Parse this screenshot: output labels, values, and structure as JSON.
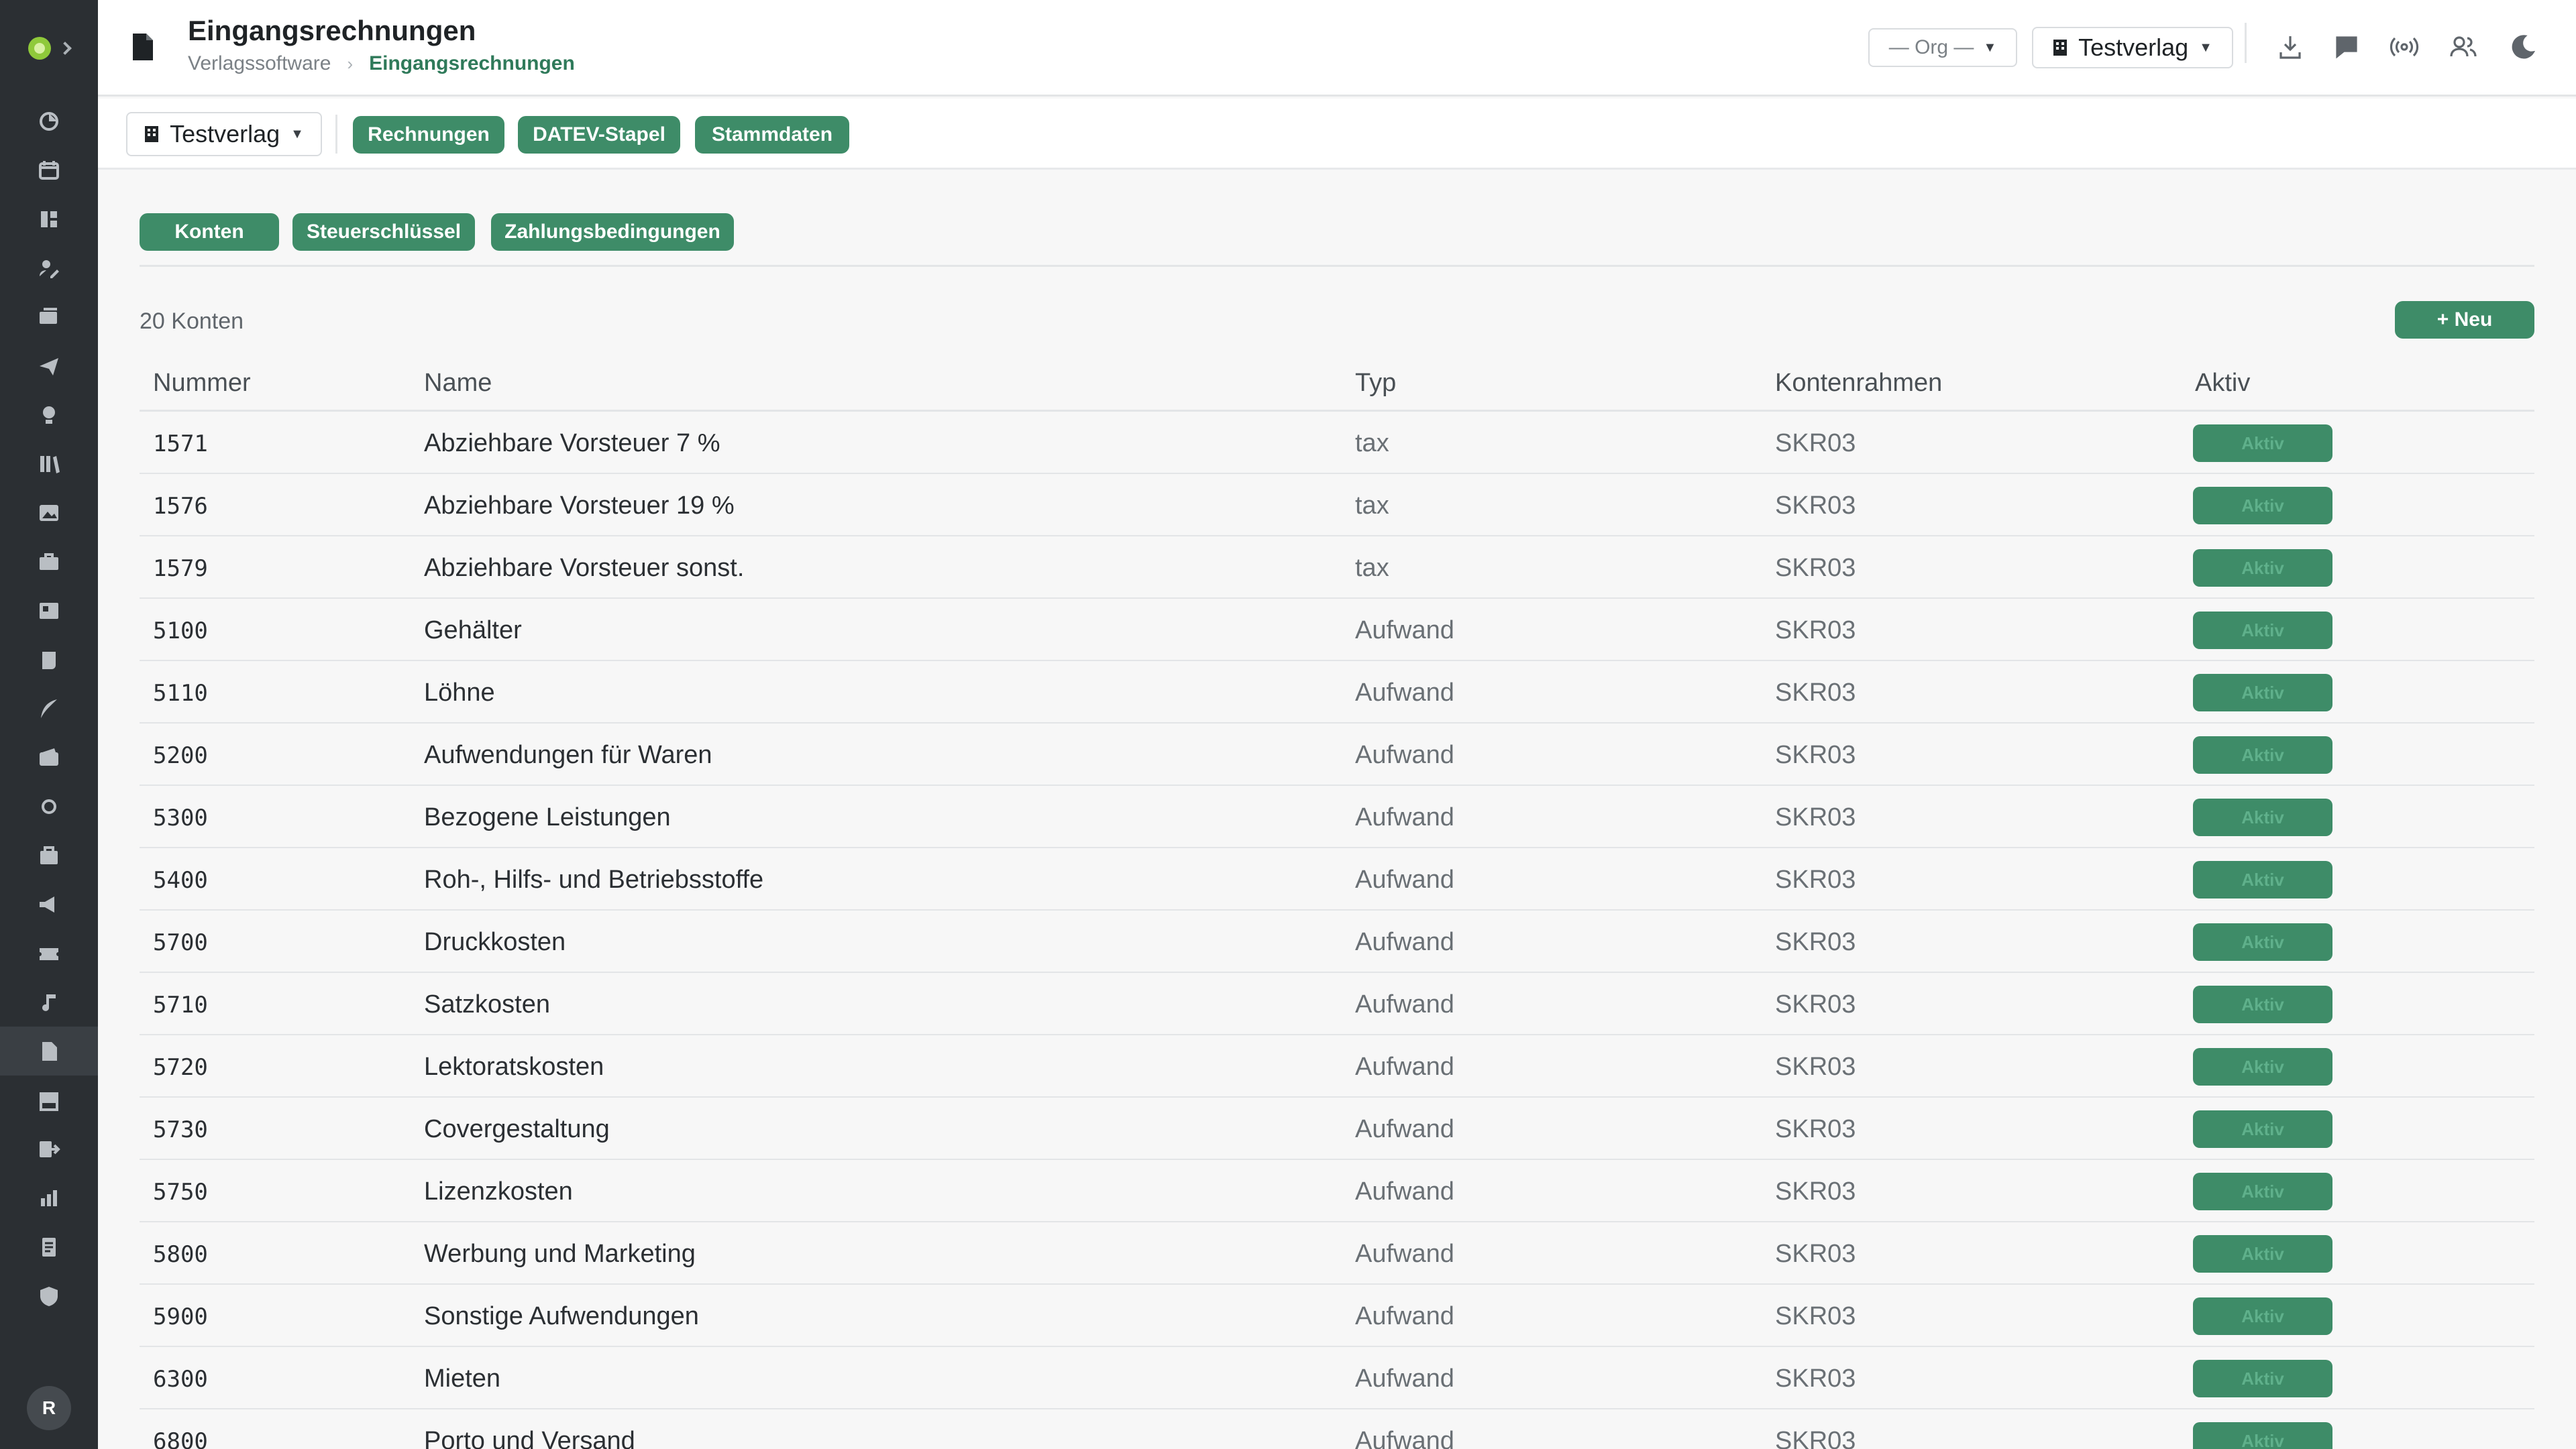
{
  "header": {
    "title": "Eingangsrechnungen",
    "breadcrumb": [
      "Verlagssoftware",
      "Eingangsrechnungen"
    ],
    "org_select": "— Org —",
    "verlag_select": "Testverlag"
  },
  "sidebar": {
    "icons": [
      "dashboard-icon",
      "calendar-icon",
      "grid-icon",
      "edit-icon",
      "inbox-icon",
      "send-icon",
      "idea-icon",
      "library-icon",
      "image-icon",
      "briefcase-icon",
      "news-icon",
      "scroll-icon",
      "quill-icon",
      "wallet-icon",
      "circle-icon",
      "bag-icon",
      "megaphone-icon",
      "ticket-icon",
      "music-icon",
      "file-icon",
      "factory-icon",
      "export-icon",
      "chart-icon",
      "receipt-icon",
      "shield-icon"
    ],
    "active_index": 19,
    "avatar_initial": "R"
  },
  "toolbar": {
    "verlag_label": "Testverlag",
    "tabs": [
      "Rechnungen",
      "DATEV-Stapel",
      "Stammdaten"
    ]
  },
  "subtabs": [
    "Konten",
    "Steuerschlüssel",
    "Zahlungsbedingungen"
  ],
  "list": {
    "count_label": "20 Konten",
    "new_button": "+ Neu",
    "columns": [
      "Nummer",
      "Name",
      "Typ",
      "Kontenrahmen",
      "Aktiv"
    ],
    "rows": [
      {
        "nummer": "1571",
        "name": "Abziehbare Vorsteuer 7 %",
        "typ": "tax",
        "rahmen": "SKR03",
        "aktiv": "Aktiv"
      },
      {
        "nummer": "1576",
        "name": "Abziehbare Vorsteuer 19 %",
        "typ": "tax",
        "rahmen": "SKR03",
        "aktiv": "Aktiv"
      },
      {
        "nummer": "1579",
        "name": "Abziehbare Vorsteuer sonst.",
        "typ": "tax",
        "rahmen": "SKR03",
        "aktiv": "Aktiv"
      },
      {
        "nummer": "5100",
        "name": "Gehälter",
        "typ": "Aufwand",
        "rahmen": "SKR03",
        "aktiv": "Aktiv"
      },
      {
        "nummer": "5110",
        "name": "Löhne",
        "typ": "Aufwand",
        "rahmen": "SKR03",
        "aktiv": "Aktiv"
      },
      {
        "nummer": "5200",
        "name": "Aufwendungen für Waren",
        "typ": "Aufwand",
        "rahmen": "SKR03",
        "aktiv": "Aktiv"
      },
      {
        "nummer": "5300",
        "name": "Bezogene Leistungen",
        "typ": "Aufwand",
        "rahmen": "SKR03",
        "aktiv": "Aktiv"
      },
      {
        "nummer": "5400",
        "name": "Roh-, Hilfs- und Betriebsstoffe",
        "typ": "Aufwand",
        "rahmen": "SKR03",
        "aktiv": "Aktiv"
      },
      {
        "nummer": "5700",
        "name": "Druckkosten",
        "typ": "Aufwand",
        "rahmen": "SKR03",
        "aktiv": "Aktiv"
      },
      {
        "nummer": "5710",
        "name": "Satzkosten",
        "typ": "Aufwand",
        "rahmen": "SKR03",
        "aktiv": "Aktiv"
      },
      {
        "nummer": "5720",
        "name": "Lektoratskosten",
        "typ": "Aufwand",
        "rahmen": "SKR03",
        "aktiv": "Aktiv"
      },
      {
        "nummer": "5730",
        "name": "Covergestaltung",
        "typ": "Aufwand",
        "rahmen": "SKR03",
        "aktiv": "Aktiv"
      },
      {
        "nummer": "5750",
        "name": "Lizenzkosten",
        "typ": "Aufwand",
        "rahmen": "SKR03",
        "aktiv": "Aktiv"
      },
      {
        "nummer": "5800",
        "name": "Werbung und Marketing",
        "typ": "Aufwand",
        "rahmen": "SKR03",
        "aktiv": "Aktiv"
      },
      {
        "nummer": "5900",
        "name": "Sonstige Aufwendungen",
        "typ": "Aufwand",
        "rahmen": "SKR03",
        "aktiv": "Aktiv"
      },
      {
        "nummer": "6300",
        "name": "Mieten",
        "typ": "Aufwand",
        "rahmen": "SKR03",
        "aktiv": "Aktiv"
      },
      {
        "nummer": "6800",
        "name": "Porto und Versand",
        "typ": "Aufwand",
        "rahmen": "SKR03",
        "aktiv": "Aktiv"
      }
    ]
  },
  "colors": {
    "accent": "#3e8c68",
    "sidebar_bg": "#2b2f33",
    "badge_text": "#5fb08b"
  }
}
